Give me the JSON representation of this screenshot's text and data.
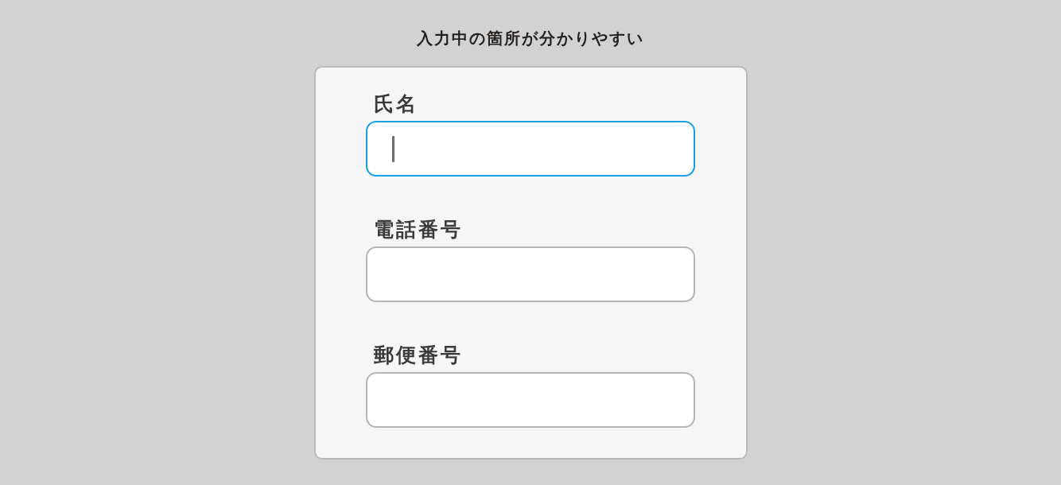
{
  "title": "入力中の箇所が分かりやすい",
  "fields": [
    {
      "label": "氏名",
      "focused": true
    },
    {
      "label": "電話番号",
      "focused": false
    },
    {
      "label": "郵便番号",
      "focused": false
    }
  ]
}
